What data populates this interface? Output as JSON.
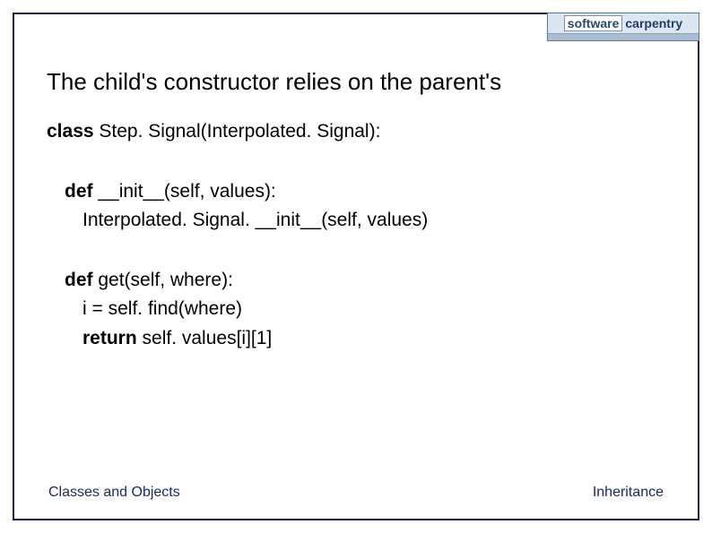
{
  "logo": {
    "word1": "software",
    "word2": "carpentry",
    "tagline": ""
  },
  "title": "The child's constructor relies on the parent's",
  "code": {
    "line1_kw": "class",
    "line1_rest": " Step. Signal(Interpolated. Signal):",
    "line2_kw": "def",
    "line2_rest": " __init__(self, values):",
    "line3": "Interpolated. Signal. __init__(self, values)",
    "line4_kw": "def",
    "line4_rest": " get(self, where):",
    "line5": "i = self. find(where)",
    "line6_kw": "return",
    "line6_rest": " self. values[i][1]"
  },
  "footer": {
    "left": "Classes and Objects",
    "right": "Inheritance"
  }
}
